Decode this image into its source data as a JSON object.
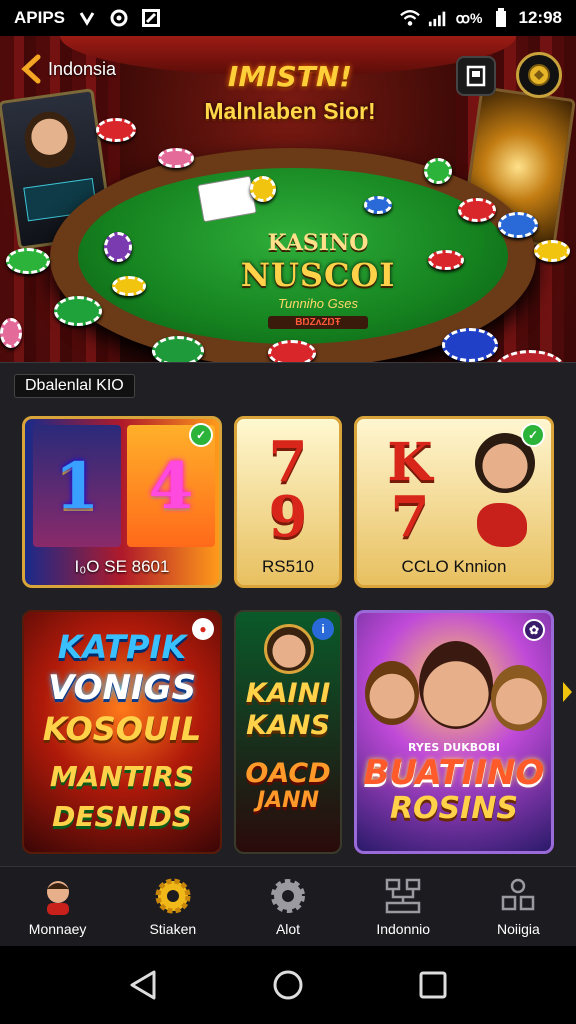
{
  "status_bar": {
    "app_label": "APIPS",
    "network_label": "ꝏ%",
    "time": "12:98"
  },
  "hero": {
    "back_label": "Indonsia",
    "title": "IMISTN!",
    "subtitle": "Malnlaben Sior!",
    "felt_title": "KASINO",
    "felt_title2": "NUSCOI",
    "felt_small": "Tunniho Gses",
    "felt_badge": "BŊZʌZŊŦ"
  },
  "section": {
    "label": "Dbalenlal KIO"
  },
  "slot_tiles": [
    {
      "reel_a": "1",
      "reel_b": "4",
      "caption": "I₀O SE 8601"
    },
    {
      "reel_a": "7",
      "reel_b": "9",
      "caption": "RS510"
    },
    {
      "reel_a": "K",
      "reel_b": "7",
      "caption": "CCLO Knnion"
    }
  ],
  "promo_tiles": [
    {
      "lines": [
        "KATPIK",
        "VONIGS",
        "KOSOUIL",
        "MANTIRS",
        "DESNIDS"
      ]
    },
    {
      "lines": [
        "KAINI",
        "KANS",
        "OACD",
        "JANN"
      ]
    },
    {
      "lines": [
        "RYES DUKBOBI",
        "BUATIINO",
        "ROSINS"
      ]
    }
  ],
  "bottom_nav": [
    {
      "label": "Monnaey",
      "icon": "avatar-icon"
    },
    {
      "label": "Stiaken",
      "icon": "gear-coin-icon"
    },
    {
      "label": "Alot",
      "icon": "settings-icon"
    },
    {
      "label": "Indonnio",
      "icon": "network-icon"
    },
    {
      "label": "Noiigia",
      "icon": "grid-icon"
    }
  ],
  "colors": {
    "accent_gold": "#ffd24a",
    "felt_green": "#15821f",
    "tile_border": "#d9a53a",
    "panel_bg": "#202024"
  }
}
